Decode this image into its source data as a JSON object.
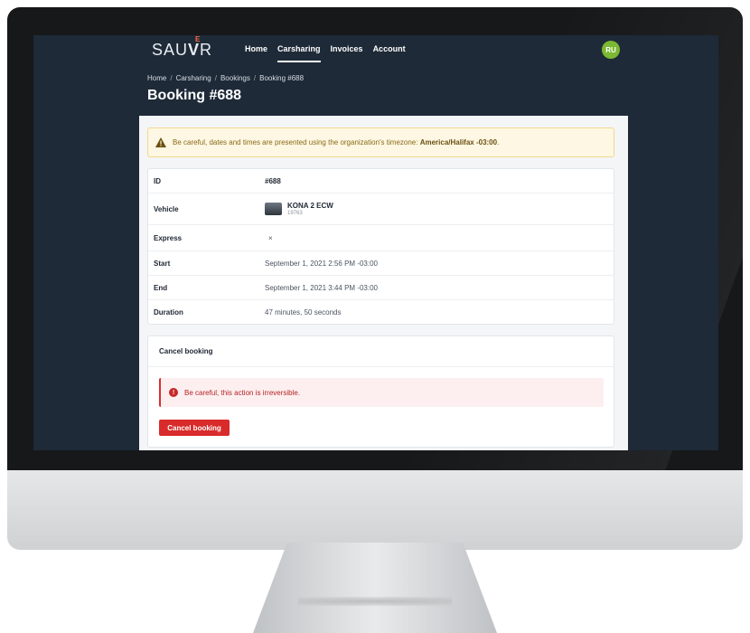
{
  "app": {
    "logo_prefix": "SAU",
    "logo_v": "V",
    "logo_sup": "E",
    "logo_suffix": "R"
  },
  "nav": {
    "items": [
      {
        "label": "Home",
        "active": false
      },
      {
        "label": "Carsharing",
        "active": true
      },
      {
        "label": "Invoices",
        "active": false
      },
      {
        "label": "Account",
        "active": false
      }
    ],
    "avatar_initials": "RU",
    "avatar_color": "#7bb833"
  },
  "breadcrumb": [
    "Home",
    "Carsharing",
    "Bookings",
    "Booking #688"
  ],
  "breadcrumb_separator": "/",
  "page_title": "Booking #688",
  "timezone_warning": {
    "text": "Be careful, dates and times are presented using the organization's timezone:",
    "timezone": "America/Halifax -03:00",
    "end": "."
  },
  "details": {
    "rows": [
      {
        "key": "ID",
        "value": "#688"
      },
      {
        "key": "Vehicle",
        "vehicle_name": "KONA 2 ECW",
        "vehicle_sub": "19763"
      },
      {
        "key": "Express",
        "value": "×"
      },
      {
        "key": "Start",
        "value": "September 1, 2021 2:56 PM -03:00"
      },
      {
        "key": "End",
        "value": "September 1, 2021 3:44 PM -03:00"
      },
      {
        "key": "Duration",
        "value": "47 minutes, 50 seconds"
      }
    ]
  },
  "cancel": {
    "title": "Cancel booking",
    "alert": "Be careful, this action is irreversible.",
    "alert_icon": "!",
    "button_label": "Cancel booking",
    "button_color": "#d92b2b"
  }
}
